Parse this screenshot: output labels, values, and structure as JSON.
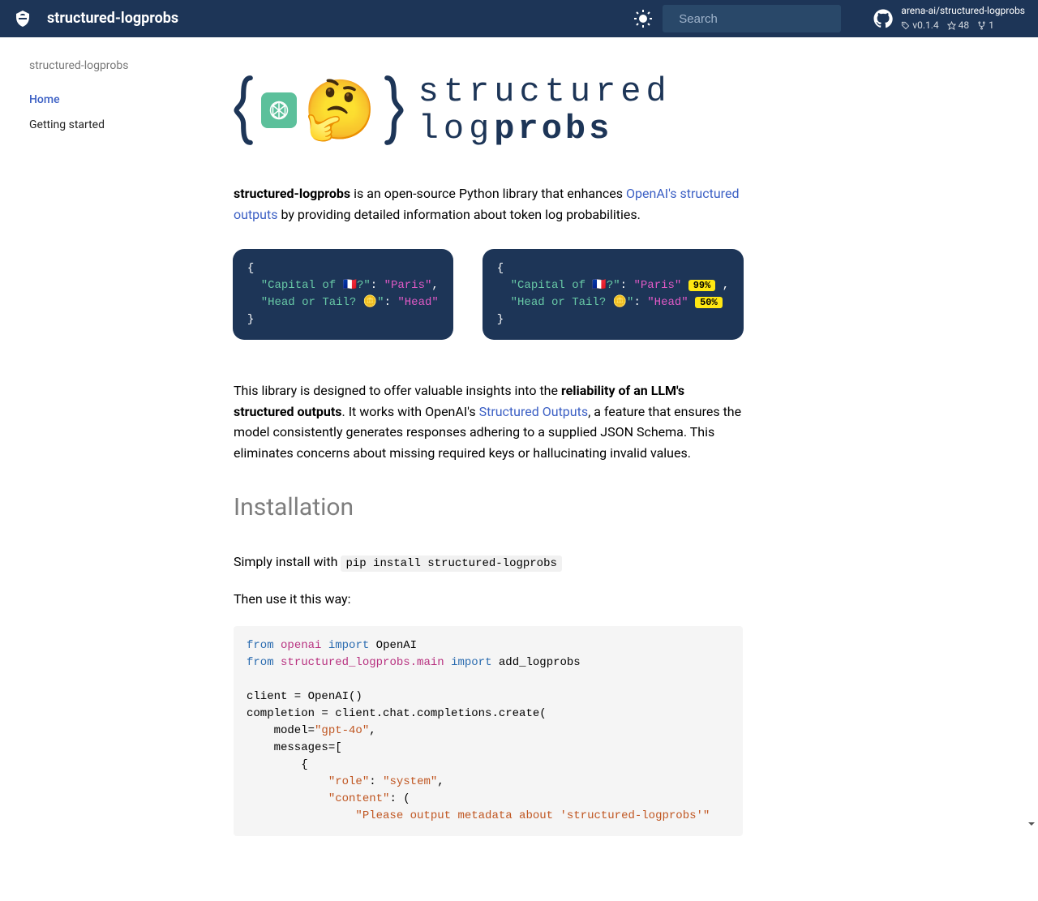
{
  "header": {
    "title": "structured-logprobs",
    "search_placeholder": "Search",
    "repo": {
      "name": "arena-ai/structured-logprobs",
      "version": "v0.1.4",
      "stars": "48",
      "forks": "1"
    }
  },
  "sidebar": {
    "title": "structured-logprobs",
    "items": [
      {
        "label": "Home",
        "active": true
      },
      {
        "label": "Getting started",
        "active": false
      }
    ]
  },
  "hero": {
    "line1": "structured",
    "line2a": "log",
    "line2b": "probs"
  },
  "intro": {
    "pre": "structured-logprobs",
    "mid": " is an open-source Python library that enhances ",
    "link": "OpenAI's structured outputs",
    "after": " by providing detailed information about token log probabilities."
  },
  "diagram": {
    "left": {
      "l1_key": "\"Capital of 🇫🇷?\"",
      "l1_val": "\"Paris\"",
      "l2_key": "\"Head or Tail? 🪙\"",
      "l2_val": "\"Head\""
    },
    "right": {
      "l1_key": "\"Capital of 🇫🇷?\"",
      "l1_val": "\"Paris\"",
      "l1_pct": "99%",
      "l2_key": "\"Head or Tail? 🪙\"",
      "l2_val": "\"Head\"",
      "l2_pct": "50%"
    }
  },
  "para2": {
    "pre": "This library is designed to offer valuable insights into the ",
    "bold": "reliability of an LLM's structured outputs",
    "mid": ". It works with OpenAI's ",
    "link": "Structured Outputs",
    "after": ", a feature that ensures the model consistently generates responses adhering to a supplied JSON Schema. This eliminates concerns about missing required keys or hallucinating invalid values."
  },
  "installation": {
    "heading": "Installation",
    "p1_pre": "Simply install with ",
    "p1_code": "pip install structured-logprobs",
    "p2": "Then use it this way:"
  },
  "code": {
    "l1_kw1": "from",
    "l1_mod": "openai",
    "l1_kw2": "import",
    "l1_name": "OpenAI",
    "l2_kw1": "from",
    "l2_mod": "structured_logprobs.main",
    "l2_kw2": "import",
    "l2_name": "add_logprobs",
    "l4": "client = OpenAI()",
    "l5": "completion = client.chat.completions.create(",
    "l6": "    model=",
    "l6_str": "\"gpt-4o\"",
    "l7": "    messages=[",
    "l8": "        {",
    "l9_key": "\"role\"",
    "l9_val": "\"system\"",
    "l10_key": "\"content\"",
    "l11_str": "\"Please output metadata about 'structured-logprobs'\""
  }
}
